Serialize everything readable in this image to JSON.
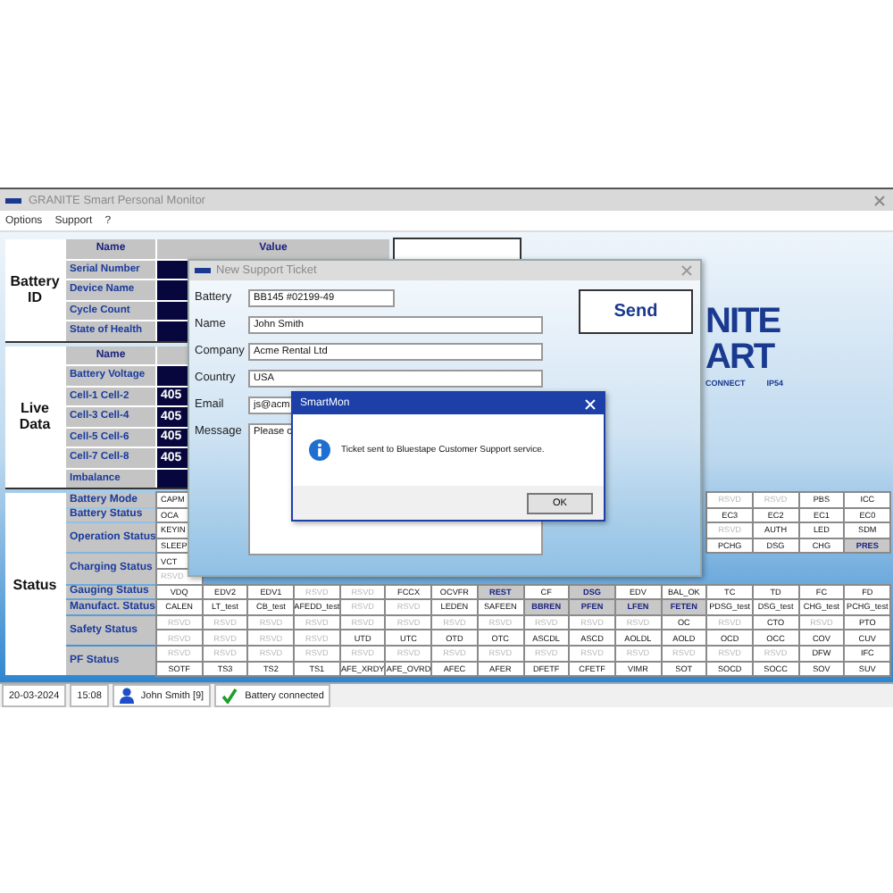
{
  "window": {
    "title": "GRANITE Smart Personal Monitor"
  },
  "menu": [
    "Options",
    "Support",
    "?"
  ],
  "battery_id": {
    "label": "Battery ID",
    "columns": [
      "Name",
      "Value"
    ],
    "rows": [
      "Serial Number",
      "Device Name",
      "Cycle Count",
      "State of Health"
    ]
  },
  "live_data": {
    "label": "Live Data",
    "columns": [
      "Name"
    ],
    "rows": [
      {
        "name": "Battery Voltage"
      },
      {
        "name": "Cell-1 Cell-2",
        "value": "405"
      },
      {
        "name": "Cell-3 Cell-4",
        "value": "405"
      },
      {
        "name": "Cell-5 Cell-6",
        "value": "405"
      },
      {
        "name": "Cell-7 Cell-8",
        "value": "405"
      },
      {
        "name": "Imbalance"
      }
    ]
  },
  "status": {
    "label": "Status",
    "groups": [
      {
        "name": "Battery Mode",
        "rows": [
          {
            "first": {
              "text": "CAPM",
              "kind": "flag",
              "set": false
            },
            "last": [
              {
                "text": "RSVD",
                "kind": "reserved",
                "set": false
              },
              {
                "text": "RSVD",
                "kind": "reserved",
                "set": false
              },
              {
                "text": "PBS",
                "kind": "flag",
                "set": false
              },
              {
                "text": "ICC",
                "kind": "flag",
                "set": false
              }
            ]
          }
        ]
      },
      {
        "name": "Battery Status",
        "rows": [
          {
            "first": {
              "text": "OCA",
              "kind": "flag",
              "set": false
            },
            "last": [
              {
                "text": "EC3",
                "kind": "flag",
                "set": false
              },
              {
                "text": "EC2",
                "kind": "flag",
                "set": false
              },
              {
                "text": "EC1",
                "kind": "flag",
                "set": false
              },
              {
                "text": "EC0",
                "kind": "flag",
                "set": false
              }
            ]
          }
        ]
      },
      {
        "name": "Operation Status",
        "rows": [
          {
            "first": {
              "text": "KEYIN",
              "kind": "flag",
              "set": false
            },
            "last": [
              {
                "text": "RSVD",
                "kind": "reserved",
                "set": false
              },
              {
                "text": "AUTH",
                "kind": "flag",
                "set": false
              },
              {
                "text": "LED",
                "kind": "flag",
                "set": false
              },
              {
                "text": "SDM",
                "kind": "flag",
                "set": false
              }
            ]
          },
          {
            "first": {
              "text": "SLEEP",
              "kind": "flag",
              "set": false
            },
            "last": [
              {
                "text": "PCHG",
                "kind": "flag",
                "set": false
              },
              {
                "text": "DSG",
                "kind": "flag",
                "set": false
              },
              {
                "text": "CHG",
                "kind": "flag",
                "set": false
              },
              {
                "text": "PRES",
                "kind": "flag",
                "set": true
              }
            ]
          }
        ]
      },
      {
        "name": "Charging Status",
        "rows": [
          {
            "first": {
              "text": "VCT",
              "kind": "flag",
              "set": false
            }
          },
          {
            "first": {
              "text": "RSVD",
              "kind": "reserved",
              "set": false
            }
          }
        ]
      },
      {
        "name": "Gauging Status",
        "rows": [
          {
            "cells": [
              {
                "text": "VDQ",
                "kind": "flag",
                "set": false
              },
              {
                "text": "EDV2",
                "kind": "flag",
                "set": false
              },
              {
                "text": "EDV1",
                "kind": "flag",
                "set": false
              },
              {
                "text": "RSVD",
                "kind": "reserved",
                "set": false
              },
              {
                "text": "RSVD",
                "kind": "reserved",
                "set": false
              },
              {
                "text": "FCCX",
                "kind": "flag",
                "set": false
              },
              {
                "text": "OCVFR",
                "kind": "flag",
                "set": false
              },
              {
                "text": "REST",
                "kind": "flag",
                "set": true
              },
              {
                "text": "CF",
                "kind": "flag",
                "set": false
              },
              {
                "text": "DSG",
                "kind": "flag",
                "set": true
              },
              {
                "text": "EDV",
                "kind": "flag",
                "set": false
              },
              {
                "text": "BAL_OK",
                "kind": "flag",
                "set": false
              },
              {
                "text": "TC",
                "kind": "flag",
                "set": false
              },
              {
                "text": "TD",
                "kind": "flag",
                "set": false
              },
              {
                "text": "FC",
                "kind": "flag",
                "set": false
              },
              {
                "text": "FD",
                "kind": "flag",
                "set": false
              }
            ]
          }
        ]
      },
      {
        "name": "Manufact. Status",
        "rows": [
          {
            "cells": [
              {
                "text": "CALEN",
                "kind": "flag",
                "set": false
              },
              {
                "text": "LT_test",
                "kind": "flag",
                "set": false
              },
              {
                "text": "CB_test",
                "kind": "flag",
                "set": false
              },
              {
                "text": "AFEDD_test",
                "kind": "flag",
                "set": false
              },
              {
                "text": "RSVD",
                "kind": "reserved",
                "set": false
              },
              {
                "text": "RSVD",
                "kind": "reserved",
                "set": false
              },
              {
                "text": "LEDEN",
                "kind": "flag",
                "set": false
              },
              {
                "text": "SAFEEN",
                "kind": "flag",
                "set": false
              },
              {
                "text": "BBREN",
                "kind": "flag",
                "set": true
              },
              {
                "text": "PFEN",
                "kind": "flag",
                "set": true
              },
              {
                "text": "LFEN",
                "kind": "flag",
                "set": true
              },
              {
                "text": "FETEN",
                "kind": "flag",
                "set": true
              },
              {
                "text": "PDSG_test",
                "kind": "flag",
                "set": false
              },
              {
                "text": "DSG_test",
                "kind": "flag",
                "set": false
              },
              {
                "text": "CHG_test",
                "kind": "flag",
                "set": false
              },
              {
                "text": "PCHG_test",
                "kind": "flag",
                "set": false
              }
            ]
          }
        ]
      },
      {
        "name": "Safety Status",
        "rows": [
          {
            "cells": [
              {
                "text": "RSVD",
                "kind": "reserved",
                "set": false
              },
              {
                "text": "RSVD",
                "kind": "reserved",
                "set": false
              },
              {
                "text": "RSVD",
                "kind": "reserved",
                "set": false
              },
              {
                "text": "RSVD",
                "kind": "reserved",
                "set": false
              },
              {
                "text": "RSVD",
                "kind": "reserved",
                "set": false
              },
              {
                "text": "RSVD",
                "kind": "reserved",
                "set": false
              },
              {
                "text": "RSVD",
                "kind": "reserved",
                "set": false
              },
              {
                "text": "RSVD",
                "kind": "reserved",
                "set": false
              },
              {
                "text": "RSVD",
                "kind": "reserved",
                "set": false
              },
              {
                "text": "RSVD",
                "kind": "reserved",
                "set": false
              },
              {
                "text": "RSVD",
                "kind": "reserved",
                "set": false
              },
              {
                "text": "OC",
                "kind": "flag",
                "set": false
              },
              {
                "text": "RSVD",
                "kind": "reserved",
                "set": false
              },
              {
                "text": "CTO",
                "kind": "flag",
                "set": false
              },
              {
                "text": "RSVD",
                "kind": "reserved",
                "set": false
              },
              {
                "text": "PTO",
                "kind": "flag",
                "set": false
              }
            ]
          },
          {
            "cells": [
              {
                "text": "RSVD",
                "kind": "reserved",
                "set": false
              },
              {
                "text": "RSVD",
                "kind": "reserved",
                "set": false
              },
              {
                "text": "RSVD",
                "kind": "reserved",
                "set": false
              },
              {
                "text": "RSVD",
                "kind": "reserved",
                "set": false
              },
              {
                "text": "UTD",
                "kind": "flag",
                "set": false
              },
              {
                "text": "UTC",
                "kind": "flag",
                "set": false
              },
              {
                "text": "OTD",
                "kind": "flag",
                "set": false
              },
              {
                "text": "OTC",
                "kind": "flag",
                "set": false
              },
              {
                "text": "ASCDL",
                "kind": "flag",
                "set": false
              },
              {
                "text": "ASCD",
                "kind": "flag",
                "set": false
              },
              {
                "text": "AOLDL",
                "kind": "flag",
                "set": false
              },
              {
                "text": "AOLD",
                "kind": "flag",
                "set": false
              },
              {
                "text": "OCD",
                "kind": "flag",
                "set": false
              },
              {
                "text": "OCC",
                "kind": "flag",
                "set": false
              },
              {
                "text": "COV",
                "kind": "flag",
                "set": false
              },
              {
                "text": "CUV",
                "kind": "flag",
                "set": false
              }
            ]
          }
        ]
      },
      {
        "name": "PF Status",
        "rows": [
          {
            "cells": [
              {
                "text": "RSVD",
                "kind": "reserved",
                "set": false
              },
              {
                "text": "RSVD",
                "kind": "reserved",
                "set": false
              },
              {
                "text": "RSVD",
                "kind": "reserved",
                "set": false
              },
              {
                "text": "RSVD",
                "kind": "reserved",
                "set": false
              },
              {
                "text": "RSVD",
                "kind": "reserved",
                "set": false
              },
              {
                "text": "RSVD",
                "kind": "reserved",
                "set": false
              },
              {
                "text": "RSVD",
                "kind": "reserved",
                "set": false
              },
              {
                "text": "RSVD",
                "kind": "reserved",
                "set": false
              },
              {
                "text": "RSVD",
                "kind": "reserved",
                "set": false
              },
              {
                "text": "RSVD",
                "kind": "reserved",
                "set": false
              },
              {
                "text": "RSVD",
                "kind": "reserved",
                "set": false
              },
              {
                "text": "RSVD",
                "kind": "reserved",
                "set": false
              },
              {
                "text": "RSVD",
                "kind": "reserved",
                "set": false
              },
              {
                "text": "RSVD",
                "kind": "reserved",
                "set": false
              },
              {
                "text": "DFW",
                "kind": "flag",
                "set": false
              },
              {
                "text": "IFC",
                "kind": "flag",
                "set": false
              }
            ]
          },
          {
            "cells": [
              {
                "text": "SOTF",
                "kind": "flag",
                "set": false
              },
              {
                "text": "TS3",
                "kind": "flag",
                "set": false
              },
              {
                "text": "TS2",
                "kind": "flag",
                "set": false
              },
              {
                "text": "TS1",
                "kind": "flag",
                "set": false
              },
              {
                "text": "AFE_XRDY",
                "kind": "flag",
                "set": false
              },
              {
                "text": "AFE_OVRD",
                "kind": "flag",
                "set": false
              },
              {
                "text": "AFEC",
                "kind": "flag",
                "set": false
              },
              {
                "text": "AFER",
                "kind": "flag",
                "set": false
              },
              {
                "text": "DFETF",
                "kind": "flag",
                "set": false
              },
              {
                "text": "CFETF",
                "kind": "flag",
                "set": false
              },
              {
                "text": "VIMR",
                "kind": "flag",
                "set": false
              },
              {
                "text": "SOT",
                "kind": "flag",
                "set": false
              },
              {
                "text": "SOCD",
                "kind": "flag",
                "set": false
              },
              {
                "text": "SOCC",
                "kind": "flag",
                "set": false
              },
              {
                "text": "SOV",
                "kind": "flag",
                "set": false
              },
              {
                "text": "SUV",
                "kind": "flag",
                "set": false
              }
            ]
          }
        ]
      }
    ]
  },
  "logo": {
    "lines": [
      "NITE",
      "ART"
    ],
    "tagline": [
      "CONNECT",
      "IP54"
    ]
  },
  "ticket_dialog": {
    "title": "New Support Ticket",
    "fields": [
      {
        "label": "Battery",
        "value": "BB145 #02199-49",
        "kind": "short"
      },
      {
        "label": "Name",
        "value": "John Smith",
        "kind": "line"
      },
      {
        "label": "Company",
        "value": "Acme Rental Ltd",
        "kind": "line"
      },
      {
        "label": "Country",
        "value": "USA",
        "kind": "line"
      },
      {
        "label": "Email",
        "value": "js@acm",
        "kind": "line"
      },
      {
        "label": "Message",
        "value": "Please c",
        "kind": "area"
      }
    ],
    "button": "Send"
  },
  "message_box": {
    "title": "SmartMon",
    "text": "Ticket sent to Bluestape Customer Support service.",
    "button": "OK"
  },
  "status_bar": {
    "date": "20-03-2024",
    "time": "15:08",
    "user": "John Smith [9]",
    "connection": "Battery connected"
  }
}
